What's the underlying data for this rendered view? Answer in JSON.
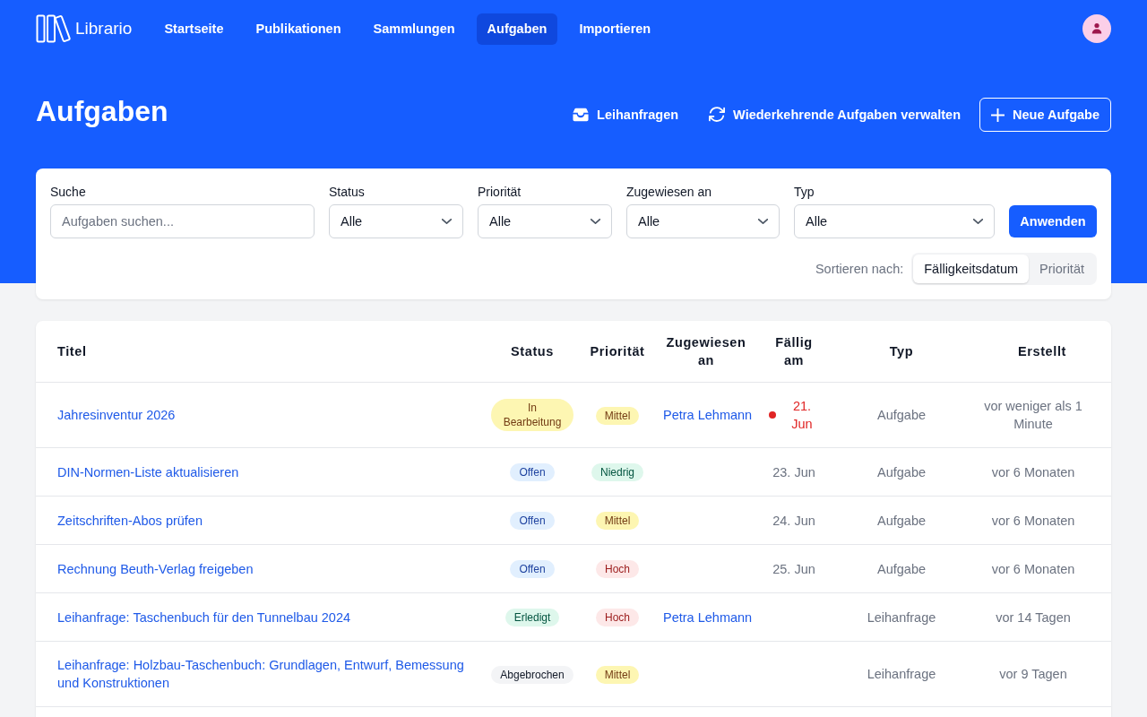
{
  "nav": {
    "logo": "Librario",
    "items": [
      {
        "label": "Startseite",
        "selected": false
      },
      {
        "label": "Publikationen",
        "selected": false
      },
      {
        "label": "Sammlungen",
        "selected": false
      },
      {
        "label": "Aufgaben",
        "selected": true
      },
      {
        "label": "Importieren",
        "selected": false
      }
    ]
  },
  "page": {
    "title": "Aufgaben",
    "actions": [
      {
        "label": "Leihanfragen",
        "kind": "link"
      },
      {
        "label": "Wiederkehrende Aufgaben verwalten",
        "kind": "link"
      },
      {
        "label": "Neue Aufgabe",
        "kind": "outlined"
      }
    ]
  },
  "filters": {
    "search": {
      "label": "Suche",
      "placeholder": "Aufgaben suchen..."
    },
    "selects": [
      {
        "label": "Status",
        "value": "Alle"
      },
      {
        "label": "Priorität",
        "value": "Alle"
      },
      {
        "label": "Zugewiesen an",
        "value": "Alle"
      },
      {
        "label": "Typ",
        "value": "Alle"
      }
    ],
    "apply": "Anwenden",
    "sort": {
      "label": "Sortieren nach:",
      "options": [
        {
          "label": "Fälligkeitsdatum",
          "selected": true
        },
        {
          "label": "Priorität",
          "selected": false
        }
      ]
    }
  },
  "table": {
    "columns": [
      "Titel",
      "Status",
      "Priorität",
      "Zugewiesen an",
      "Fällig am",
      "Typ",
      "Erstellt"
    ],
    "rows": [
      {
        "title": "Jahresinventur 2026",
        "status": {
          "label": "In Bearbeitung",
          "kind": "in_progress"
        },
        "priority": {
          "label": "Mittel",
          "kind": "medium"
        },
        "assignee": "Petra Lehmann",
        "due": {
          "text": "21. Jun",
          "overdue": true
        },
        "type": "Aufgabe",
        "created": "vor weniger als 1 Minute"
      },
      {
        "title": "DIN-Normen-Liste aktualisieren",
        "status": {
          "label": "Offen",
          "kind": "open"
        },
        "priority": {
          "label": "Niedrig",
          "kind": "low"
        },
        "due": {
          "text": "23. Jun",
          "overdue": false
        },
        "type": "Aufgabe",
        "created": "vor 6 Monaten"
      },
      {
        "title": "Zeitschriften-Abos prüfen",
        "status": {
          "label": "Offen",
          "kind": "open"
        },
        "priority": {
          "label": "Mittel",
          "kind": "medium"
        },
        "due": {
          "text": "24. Jun",
          "overdue": false
        },
        "type": "Aufgabe",
        "created": "vor 6 Monaten"
      },
      {
        "title": "Rechnung Beuth-Verlag freigeben",
        "status": {
          "label": "Offen",
          "kind": "open"
        },
        "priority": {
          "label": "Hoch",
          "kind": "high"
        },
        "due": {
          "text": "25. Jun",
          "overdue": false
        },
        "type": "Aufgabe",
        "created": "vor 6 Monaten"
      },
      {
        "title": "Leihanfrage: Taschenbuch für den Tunnelbau 2024",
        "status": {
          "label": "Erledigt",
          "kind": "done"
        },
        "priority": {
          "label": "Hoch",
          "kind": "high"
        },
        "assignee": "Petra Lehmann",
        "type": "Leihanfrage",
        "created": "vor 14 Tagen"
      },
      {
        "title": "Leihanfrage: Holzbau-Taschenbuch: Grundlagen, Entwurf, Bemessung und Konstruktionen",
        "status": {
          "label": "Abgebrochen",
          "kind": "cancelled"
        },
        "priority": {
          "label": "Mittel",
          "kind": "medium"
        },
        "type": "Leihanfrage",
        "created": "vor 9 Tagen"
      }
    ]
  }
}
